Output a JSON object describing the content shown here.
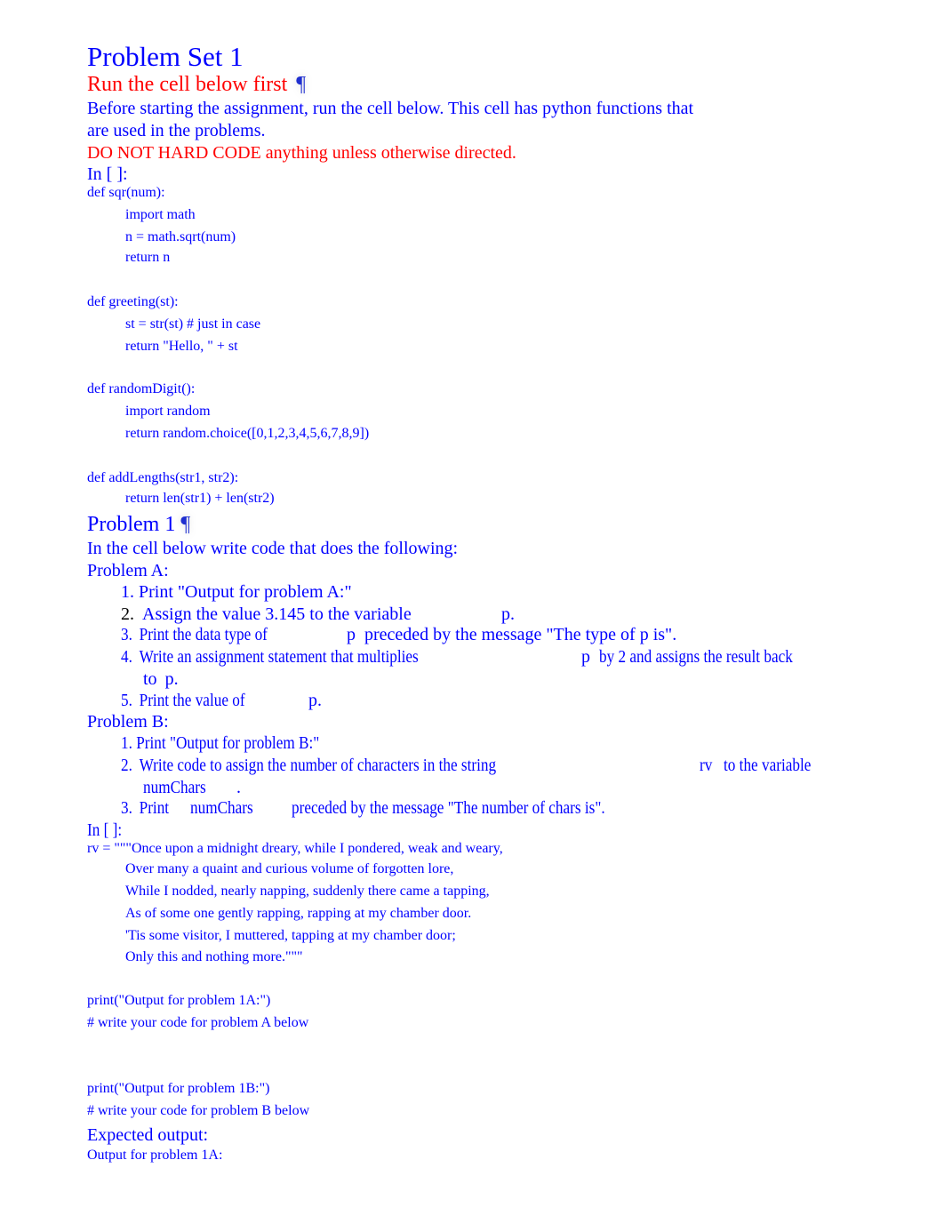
{
  "document": {
    "title": "Problem Set 1",
    "pilcrow_glyph": "¶",
    "intro": {
      "heading": "Run the cell below first",
      "line1": "Before starting the assignment, run the cell below. This cell has python functions that",
      "line2": "are used in the problems.",
      "warning_red": "DO NOT HARD CODE",
      "warning_rest": " anything unless otherwise directed."
    },
    "cell1": {
      "prompt": "In [ ]:",
      "lines": [
        {
          "indent": false,
          "text": "def sqr(num):"
        },
        {
          "indent": true,
          "text": "import math"
        },
        {
          "indent": true,
          "text": "n = math.sqrt(num)"
        },
        {
          "indent": true,
          "text": "return n"
        },
        {
          "indent": false,
          "text": "def greeting(st):"
        },
        {
          "indent": true,
          "text": "st = str(st) # just in case"
        },
        {
          "indent": true,
          "text": "return \"Hello, \" + st"
        },
        {
          "indent": false,
          "text": "def randomDigit():"
        },
        {
          "indent": true,
          "text": "import random"
        },
        {
          "indent": true,
          "text": "return random.choice([0,1,2,3,4,5,6,7,8,9])"
        },
        {
          "indent": false,
          "text": "def addLengths(str1, str2):"
        },
        {
          "indent": true,
          "text": "return len(str1) + len(str2)"
        }
      ]
    },
    "problem1": {
      "heading": "Problem 1",
      "intro": "In the cell below write code that does the following:",
      "partA": {
        "label": "Problem A:",
        "items": [
          {
            "num": "1.",
            "text": "Print \"Output for problem A:\""
          },
          {
            "num": "2.",
            "text": "Assign the value 3.145 to the variable",
            "var": "p",
            "after": "."
          },
          {
            "num": "3.",
            "text": "Print the data type of",
            "var": "p",
            "after": "preceded by the message \"The type of p is\"."
          },
          {
            "num": "4.",
            "text": "Write an assignment statement that multiplies",
            "var": "p",
            "after": "by 2 and assigns the result back",
            "cont_text": "to",
            "cont_var": "p",
            "cont_after": "."
          },
          {
            "num": "5.",
            "text": "Print the value of",
            "var": "p",
            "after": "."
          }
        ]
      },
      "partB": {
        "label": "Problem B:",
        "items": [
          {
            "num": "1.",
            "text": "Print \"Output for problem B:\""
          },
          {
            "num": "2.",
            "text": "Write code to assign the number of characters in the string",
            "var": "rv",
            "after": "to the variable",
            "cont_var": "numChars",
            "cont_after": "."
          },
          {
            "num": "3.",
            "text": "Print",
            "var": "numChars",
            "after": "preceded by the message \"The number of chars is\"."
          }
        ]
      }
    },
    "cell2": {
      "prompt": "In [ ]:",
      "lines": [
        {
          "indent": false,
          "text": "rv = \"\"\"Once upon a midnight dreary, while I pondered, weak and weary,"
        },
        {
          "indent": true,
          "text": "Over many a quaint and curious volume of forgotten lore,"
        },
        {
          "indent": true,
          "text": "While I nodded, nearly napping, suddenly there came a tapping,"
        },
        {
          "indent": true,
          "text": "As of some one gently rapping, rapping at my chamber door."
        },
        {
          "indent": true,
          "text": "'Tis some visitor, I muttered, tapping at my chamber door;"
        },
        {
          "indent": true,
          "text": "Only this and nothing more.\"\"\""
        },
        {
          "indent": false,
          "text": "print(\"Output for problem 1A:\")"
        },
        {
          "indent": false,
          "text": "# write your code for problem A below"
        },
        {
          "indent": false,
          "text": "print(\"Output for problem 1B:\")"
        },
        {
          "indent": false,
          "text": "# write your code for problem B below"
        }
      ]
    },
    "expected": {
      "heading": "Expected output:",
      "lines": [
        "Output for problem 1A:"
      ]
    }
  }
}
